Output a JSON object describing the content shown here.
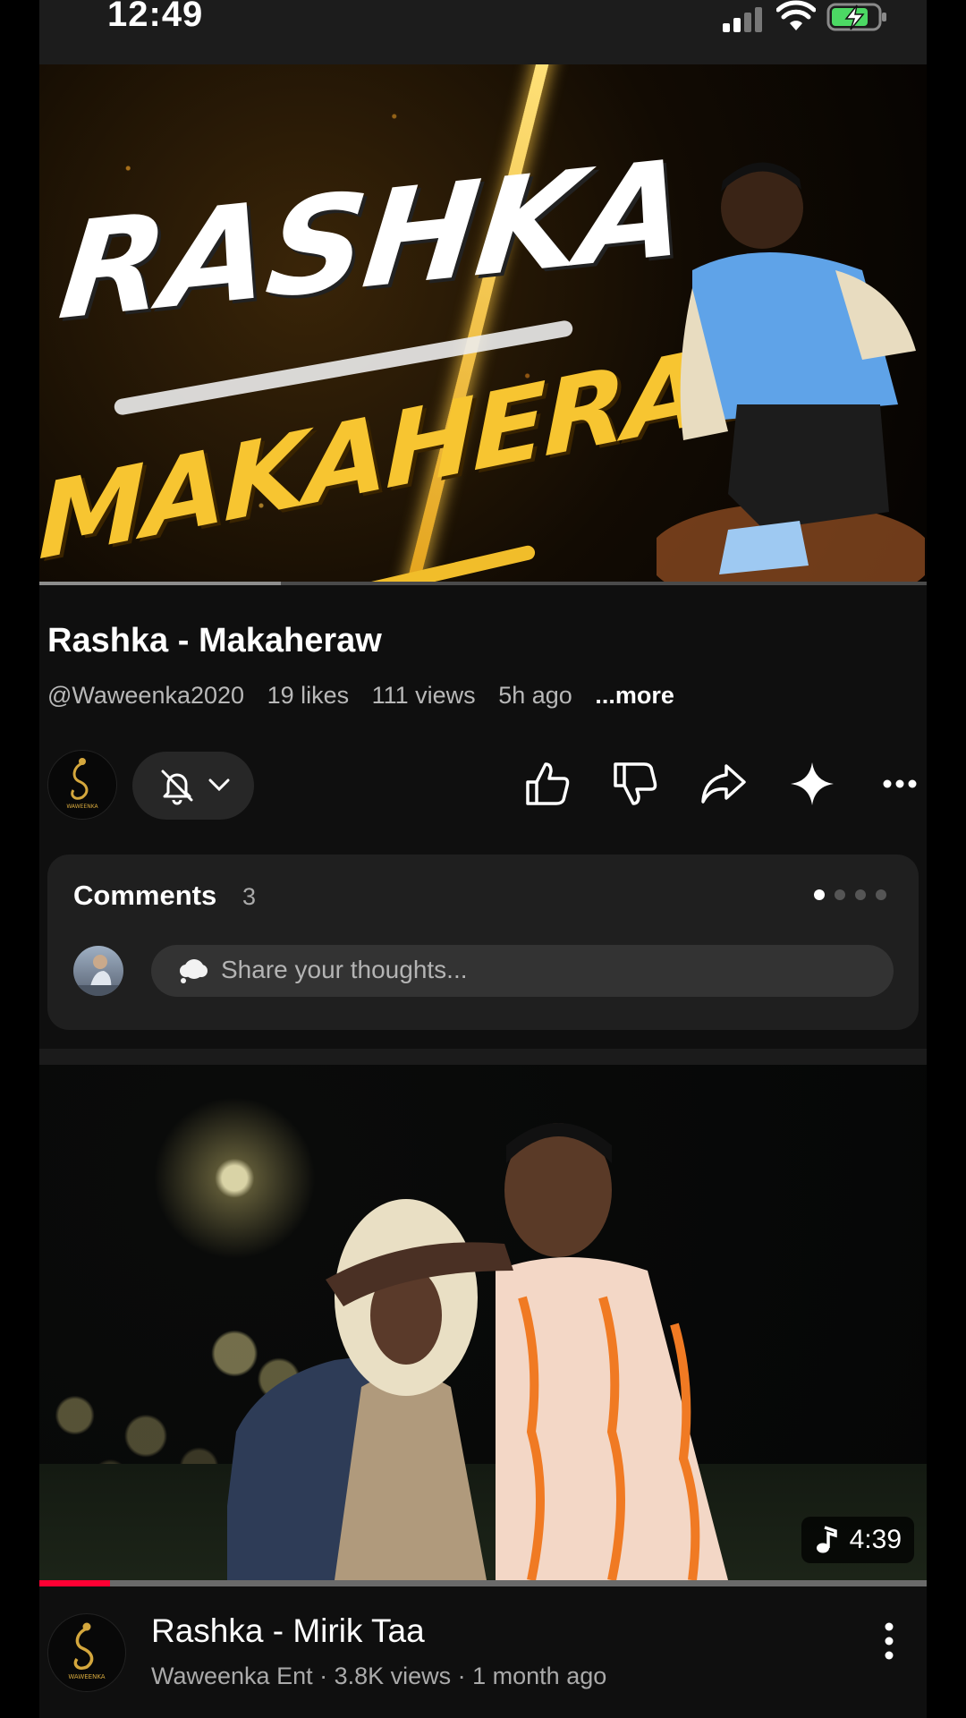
{
  "status_bar": {
    "time": "12:49"
  },
  "video": {
    "thumbnail_title_line1": "RASHKA",
    "thumbnail_title_line2": "MAKAHERAW",
    "title": "Rashka - Makaheraw",
    "channel_handle": "@Waweenka2020",
    "likes": "19 likes",
    "views": "111 views",
    "age": "5h ago",
    "more_label": "...more",
    "channel_logo_text": "WAWEENKA"
  },
  "comments": {
    "title": "Comments",
    "count": "3",
    "placeholder": "Share your thoughts..."
  },
  "next_video": {
    "duration": "4:39",
    "title": "Rashka - Mirik Taa",
    "meta": "Waweenka Ent · 3.8K views · 1 month ago",
    "channel_logo_text": "WAWEENKA",
    "watch_progress": 0.08
  },
  "colors": {
    "accent_red": "#ff0033",
    "gold": "#f7c531",
    "card": "#1f1f1f"
  }
}
